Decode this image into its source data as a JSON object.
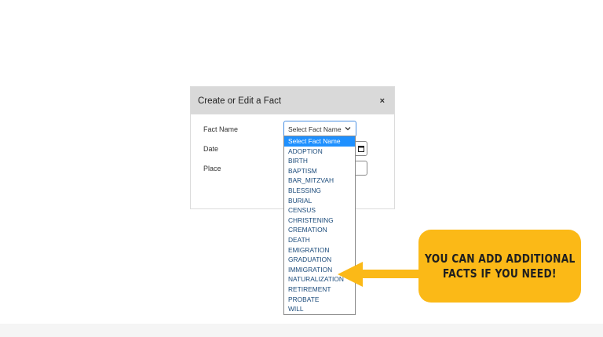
{
  "modal": {
    "title": "Create or Edit a Fact",
    "close_label": "×",
    "fields": {
      "fact_name_label": "Fact Name",
      "date_label": "Date",
      "place_label": "Place"
    },
    "select": {
      "selected_value": "Select Fact Name",
      "icon": "chevron-down-icon"
    }
  },
  "dropdown": {
    "options": [
      "Select Fact Name",
      "ADOPTION",
      "BIRTH",
      "BAPTISM",
      "BAR_MITZVAH",
      "BLESSING",
      "BURIAL",
      "CENSUS",
      "CHRISTENING",
      "CREMATION",
      "DEATH",
      "EMIGRATION",
      "GRADUATION",
      "IMMIGRATION",
      "NATURALIZATION",
      "RETIREMENT",
      "PROBATE",
      "WILL"
    ],
    "selected_index": 0,
    "highlight_color": "#1e90ff"
  },
  "callout": {
    "line1": "YOU CAN ADD ADDITIONAL",
    "line2": "FACTS IF YOU NEED!",
    "color": "#fbb917"
  }
}
